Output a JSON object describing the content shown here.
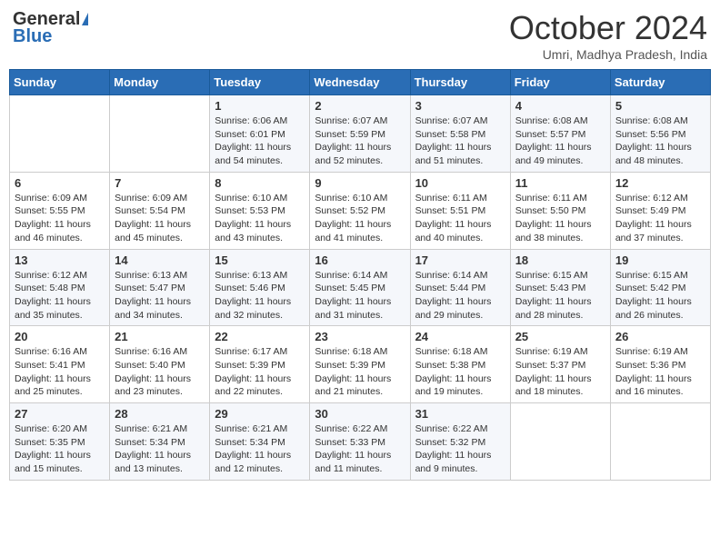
{
  "header": {
    "logo_general": "General",
    "logo_blue": "Blue",
    "title": "October 2024",
    "location": "Umri, Madhya Pradesh, India"
  },
  "columns": [
    "Sunday",
    "Monday",
    "Tuesday",
    "Wednesday",
    "Thursday",
    "Friday",
    "Saturday"
  ],
  "weeks": [
    [
      {
        "day": "",
        "info": []
      },
      {
        "day": "",
        "info": []
      },
      {
        "day": "1",
        "info": [
          "Sunrise: 6:06 AM",
          "Sunset: 6:01 PM",
          "Daylight: 11 hours",
          "and 54 minutes."
        ]
      },
      {
        "day": "2",
        "info": [
          "Sunrise: 6:07 AM",
          "Sunset: 5:59 PM",
          "Daylight: 11 hours",
          "and 52 minutes."
        ]
      },
      {
        "day": "3",
        "info": [
          "Sunrise: 6:07 AM",
          "Sunset: 5:58 PM",
          "Daylight: 11 hours",
          "and 51 minutes."
        ]
      },
      {
        "day": "4",
        "info": [
          "Sunrise: 6:08 AM",
          "Sunset: 5:57 PM",
          "Daylight: 11 hours",
          "and 49 minutes."
        ]
      },
      {
        "day": "5",
        "info": [
          "Sunrise: 6:08 AM",
          "Sunset: 5:56 PM",
          "Daylight: 11 hours",
          "and 48 minutes."
        ]
      }
    ],
    [
      {
        "day": "6",
        "info": [
          "Sunrise: 6:09 AM",
          "Sunset: 5:55 PM",
          "Daylight: 11 hours",
          "and 46 minutes."
        ]
      },
      {
        "day": "7",
        "info": [
          "Sunrise: 6:09 AM",
          "Sunset: 5:54 PM",
          "Daylight: 11 hours",
          "and 45 minutes."
        ]
      },
      {
        "day": "8",
        "info": [
          "Sunrise: 6:10 AM",
          "Sunset: 5:53 PM",
          "Daylight: 11 hours",
          "and 43 minutes."
        ]
      },
      {
        "day": "9",
        "info": [
          "Sunrise: 6:10 AM",
          "Sunset: 5:52 PM",
          "Daylight: 11 hours",
          "and 41 minutes."
        ]
      },
      {
        "day": "10",
        "info": [
          "Sunrise: 6:11 AM",
          "Sunset: 5:51 PM",
          "Daylight: 11 hours",
          "and 40 minutes."
        ]
      },
      {
        "day": "11",
        "info": [
          "Sunrise: 6:11 AM",
          "Sunset: 5:50 PM",
          "Daylight: 11 hours",
          "and 38 minutes."
        ]
      },
      {
        "day": "12",
        "info": [
          "Sunrise: 6:12 AM",
          "Sunset: 5:49 PM",
          "Daylight: 11 hours",
          "and 37 minutes."
        ]
      }
    ],
    [
      {
        "day": "13",
        "info": [
          "Sunrise: 6:12 AM",
          "Sunset: 5:48 PM",
          "Daylight: 11 hours",
          "and 35 minutes."
        ]
      },
      {
        "day": "14",
        "info": [
          "Sunrise: 6:13 AM",
          "Sunset: 5:47 PM",
          "Daylight: 11 hours",
          "and 34 minutes."
        ]
      },
      {
        "day": "15",
        "info": [
          "Sunrise: 6:13 AM",
          "Sunset: 5:46 PM",
          "Daylight: 11 hours",
          "and 32 minutes."
        ]
      },
      {
        "day": "16",
        "info": [
          "Sunrise: 6:14 AM",
          "Sunset: 5:45 PM",
          "Daylight: 11 hours",
          "and 31 minutes."
        ]
      },
      {
        "day": "17",
        "info": [
          "Sunrise: 6:14 AM",
          "Sunset: 5:44 PM",
          "Daylight: 11 hours",
          "and 29 minutes."
        ]
      },
      {
        "day": "18",
        "info": [
          "Sunrise: 6:15 AM",
          "Sunset: 5:43 PM",
          "Daylight: 11 hours",
          "and 28 minutes."
        ]
      },
      {
        "day": "19",
        "info": [
          "Sunrise: 6:15 AM",
          "Sunset: 5:42 PM",
          "Daylight: 11 hours",
          "and 26 minutes."
        ]
      }
    ],
    [
      {
        "day": "20",
        "info": [
          "Sunrise: 6:16 AM",
          "Sunset: 5:41 PM",
          "Daylight: 11 hours",
          "and 25 minutes."
        ]
      },
      {
        "day": "21",
        "info": [
          "Sunrise: 6:16 AM",
          "Sunset: 5:40 PM",
          "Daylight: 11 hours",
          "and 23 minutes."
        ]
      },
      {
        "day": "22",
        "info": [
          "Sunrise: 6:17 AM",
          "Sunset: 5:39 PM",
          "Daylight: 11 hours",
          "and 22 minutes."
        ]
      },
      {
        "day": "23",
        "info": [
          "Sunrise: 6:18 AM",
          "Sunset: 5:39 PM",
          "Daylight: 11 hours",
          "and 21 minutes."
        ]
      },
      {
        "day": "24",
        "info": [
          "Sunrise: 6:18 AM",
          "Sunset: 5:38 PM",
          "Daylight: 11 hours",
          "and 19 minutes."
        ]
      },
      {
        "day": "25",
        "info": [
          "Sunrise: 6:19 AM",
          "Sunset: 5:37 PM",
          "Daylight: 11 hours",
          "and 18 minutes."
        ]
      },
      {
        "day": "26",
        "info": [
          "Sunrise: 6:19 AM",
          "Sunset: 5:36 PM",
          "Daylight: 11 hours",
          "and 16 minutes."
        ]
      }
    ],
    [
      {
        "day": "27",
        "info": [
          "Sunrise: 6:20 AM",
          "Sunset: 5:35 PM",
          "Daylight: 11 hours",
          "and 15 minutes."
        ]
      },
      {
        "day": "28",
        "info": [
          "Sunrise: 6:21 AM",
          "Sunset: 5:34 PM",
          "Daylight: 11 hours",
          "and 13 minutes."
        ]
      },
      {
        "day": "29",
        "info": [
          "Sunrise: 6:21 AM",
          "Sunset: 5:34 PM",
          "Daylight: 11 hours",
          "and 12 minutes."
        ]
      },
      {
        "day": "30",
        "info": [
          "Sunrise: 6:22 AM",
          "Sunset: 5:33 PM",
          "Daylight: 11 hours",
          "and 11 minutes."
        ]
      },
      {
        "day": "31",
        "info": [
          "Sunrise: 6:22 AM",
          "Sunset: 5:32 PM",
          "Daylight: 11 hours",
          "and 9 minutes."
        ]
      },
      {
        "day": "",
        "info": []
      },
      {
        "day": "",
        "info": []
      }
    ]
  ]
}
